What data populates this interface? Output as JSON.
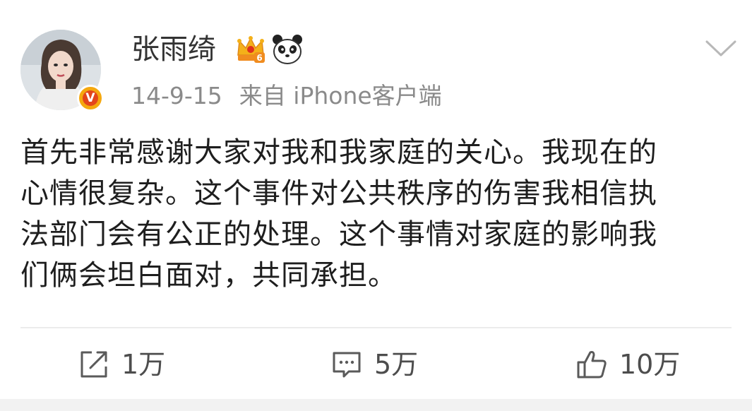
{
  "user": {
    "name": "张雨绮",
    "verified_mark": "V"
  },
  "meta": {
    "date": "14-9-15",
    "source": "来自 iPhone客户端"
  },
  "content": {
    "lines": [
      "首先非常感谢大家对我和我家庭的关心。我现在的",
      "心情很复杂。这个事件对公共秩序的伤害我相信执",
      "法部门会有公正的处理。这个事情对家庭的影响我",
      "们俩会坦白面对，共同承担。"
    ]
  },
  "actions": {
    "repost_count": "1万",
    "comment_count": "5万",
    "like_count": "10万"
  },
  "icons": {
    "vip": "crown-vip-icon",
    "panda": "panda-icon",
    "more": "chevron-down-icon",
    "repost": "repost-icon",
    "comment": "comment-icon",
    "like": "thumbs-up-icon"
  },
  "colors": {
    "text": "#1e1e1e",
    "meta": "#8a8a8a",
    "verified_badge": "#f5a80e",
    "verified_inner": "#e3461b",
    "divider": "#ececec"
  }
}
